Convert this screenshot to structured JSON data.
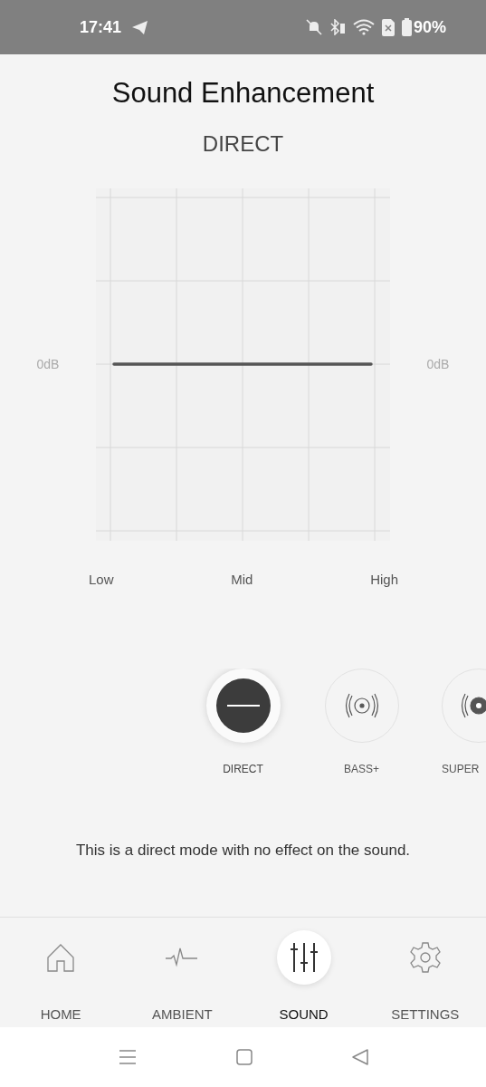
{
  "status_bar": {
    "time": "17:41",
    "battery": "90%"
  },
  "title": "Sound Enhancement",
  "mode_name": "DIRECT",
  "eq": {
    "left_label": "0dB",
    "right_label": "0dB",
    "x_labels": [
      "Low",
      "Mid",
      "High"
    ]
  },
  "modes": [
    {
      "kind": "direct",
      "label": "DIRECT",
      "selected": true
    },
    {
      "kind": "bass",
      "label": "BASS+",
      "selected": false
    },
    {
      "kind": "superbass",
      "label": "SUPER",
      "selected": false
    }
  ],
  "description": "This is a direct mode with no effect on the sound.",
  "nav": [
    {
      "kind": "home",
      "label": "HOME",
      "selected": false
    },
    {
      "kind": "ambient",
      "label": "AMBIENT",
      "selected": false
    },
    {
      "kind": "sound",
      "label": "SOUND",
      "selected": true
    },
    {
      "kind": "settings",
      "label": "SETTINGS",
      "selected": false
    }
  ]
}
